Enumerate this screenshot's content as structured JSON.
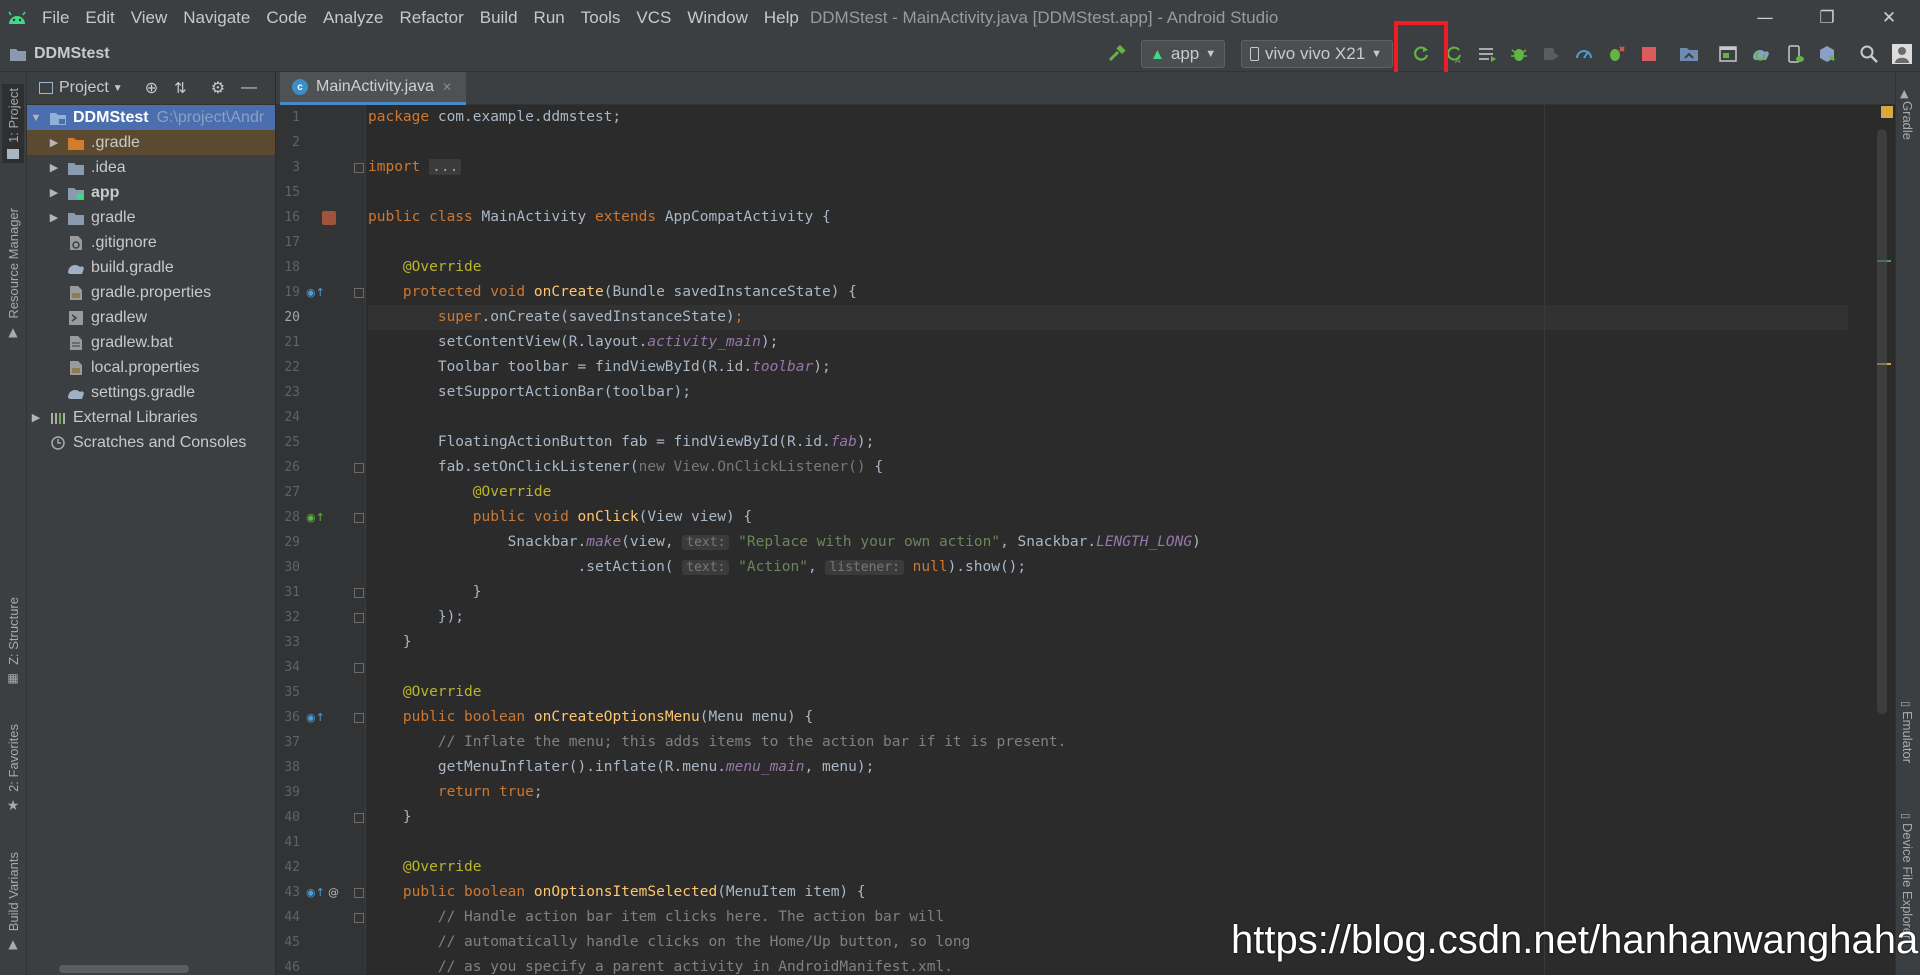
{
  "titlebar": {
    "menu": [
      "File",
      "Edit",
      "View",
      "Navigate",
      "Code",
      "Analyze",
      "Refactor",
      "Build",
      "Run",
      "Tools",
      "VCS",
      "Window",
      "Help"
    ],
    "window_title": "DDMStest - MainActivity.java [DDMStest.app] - Android Studio"
  },
  "navbar": {
    "project": "DDMStest",
    "run_config": "app",
    "device": "vivo vivo X21"
  },
  "left_strip": {
    "project": "1: Project",
    "resource_manager": "Resource Manager",
    "structure": "Z: Structure",
    "favorites": "2: Favorites",
    "build_variants": "Build Variants"
  },
  "right_strip": {
    "gradle": "Gradle",
    "emulator": "Emulator",
    "device_file_explorer": "Device File Explorer"
  },
  "project_panel": {
    "title": "Project",
    "tree": [
      {
        "label": "DDMStest",
        "path": "G:\\project\\Andr",
        "bold": true
      },
      {
        "label": ".gradle"
      },
      {
        "label": ".idea"
      },
      {
        "label": "app",
        "bold": true
      },
      {
        "label": "gradle"
      },
      {
        "label": ".gitignore"
      },
      {
        "label": "build.gradle"
      },
      {
        "label": "gradle.properties"
      },
      {
        "label": "gradlew"
      },
      {
        "label": "gradlew.bat"
      },
      {
        "label": "local.properties"
      },
      {
        "label": "settings.gradle"
      },
      {
        "label": "External Libraries"
      },
      {
        "label": "Scratches and Consoles"
      }
    ]
  },
  "editor": {
    "tab": "MainActivity.java",
    "line_numbers": [
      "1",
      "2",
      "3",
      "15",
      "16",
      "17",
      "18",
      "19",
      "20",
      "21",
      "22",
      "23",
      "24",
      "25",
      "26",
      "27",
      "28",
      "29",
      "30",
      "31",
      "32",
      "33",
      "34",
      "35",
      "36",
      "37",
      "38",
      "39",
      "40",
      "41",
      "42",
      "43",
      "44",
      "45",
      "46"
    ]
  },
  "watermark": "https://blog.csdn.net/hanhanwanghaha",
  "colors": {
    "accent": "#4a88c7",
    "highlight_box": "#ee1c24",
    "bg": "#2b2b2b",
    "panel": "#3c3f41"
  }
}
